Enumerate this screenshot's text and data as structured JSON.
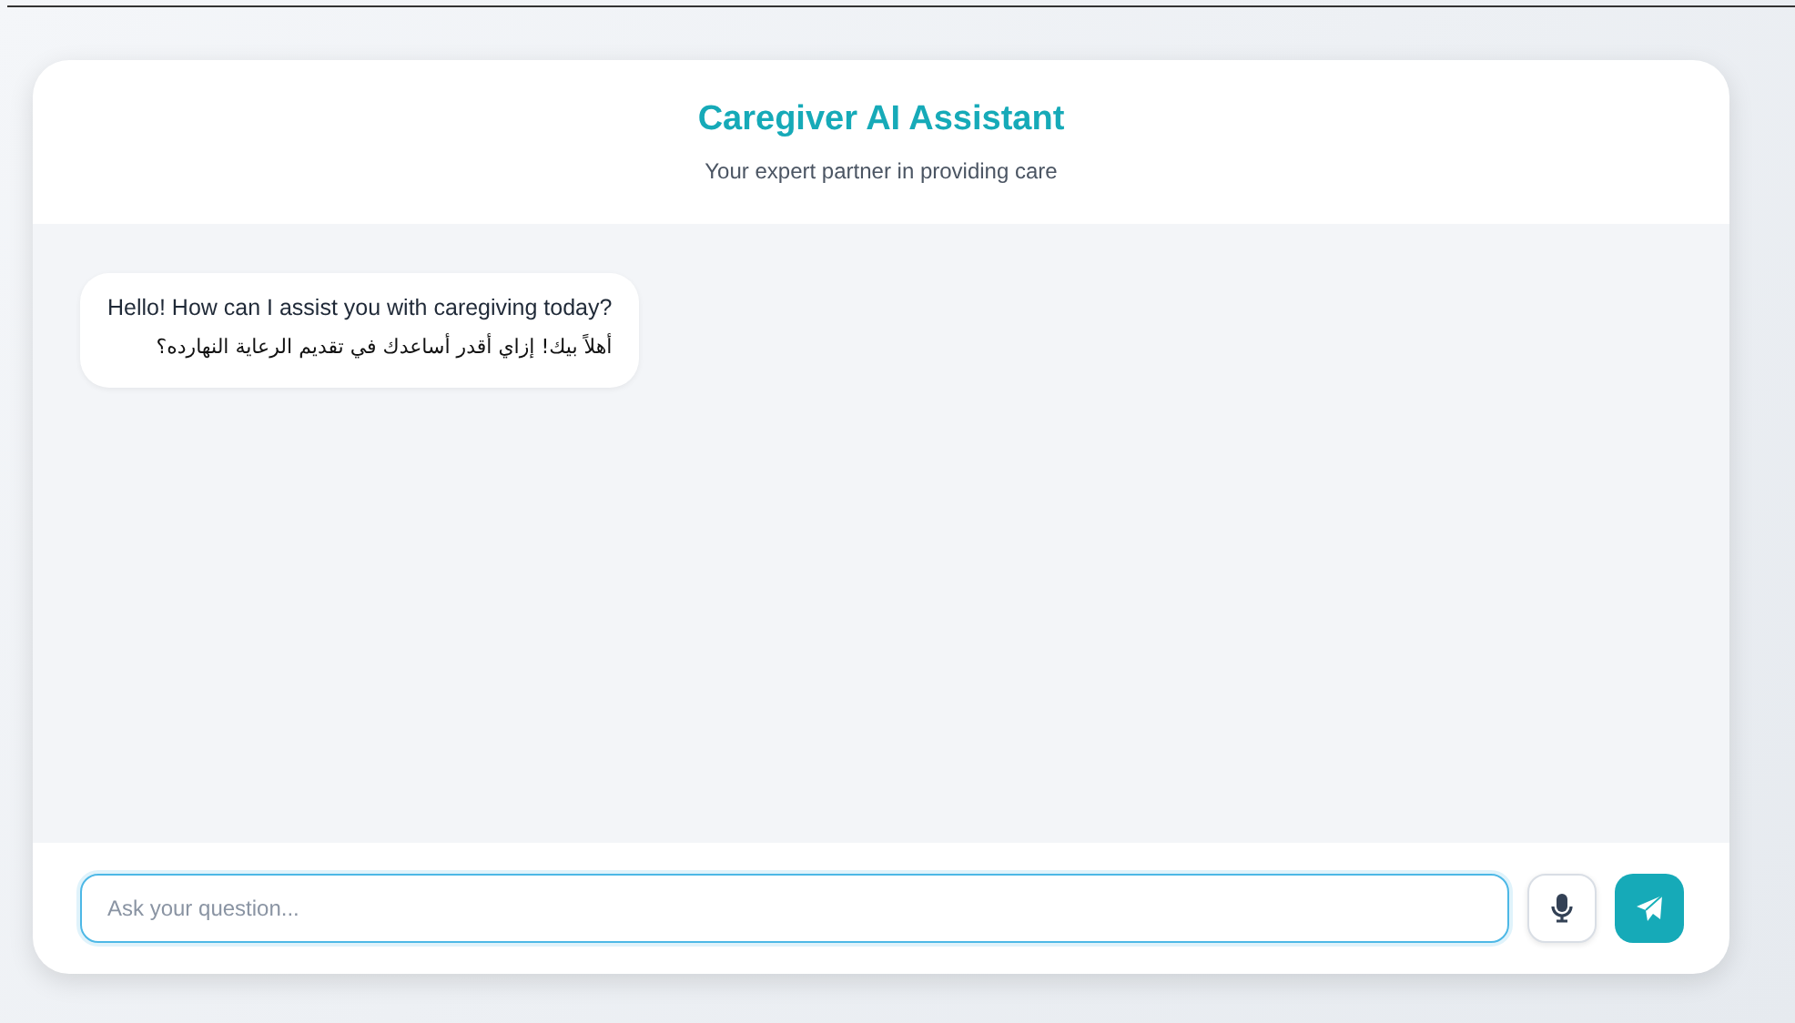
{
  "header": {
    "title": "Caregiver AI Assistant",
    "subtitle": "Your expert partner in providing care"
  },
  "messages": [
    {
      "kind": "incoming",
      "lines": [
        "Hello! How can I assist you with caregiving today?",
        "أهلاً بيك! إزاي أقدر أساعدك في تقديم الرعاية النهارده؟"
      ]
    }
  ],
  "composer": {
    "placeholder": "Ask your question..."
  }
}
